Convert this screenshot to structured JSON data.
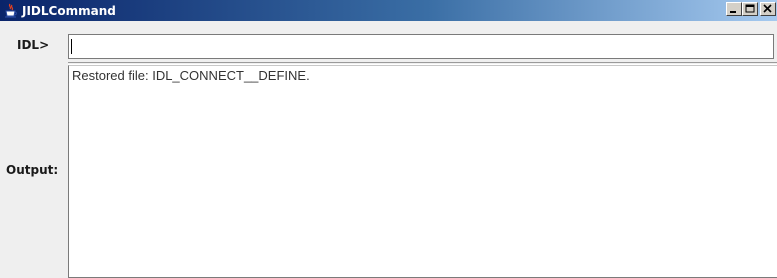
{
  "window": {
    "title": "JIDLCommand",
    "icon": "java-cup-icon",
    "controls": {
      "minimize_icon": "minimize-icon",
      "maximize_icon": "maximize-icon",
      "close_icon": "close-icon"
    }
  },
  "command": {
    "label": "IDL>",
    "value": ""
  },
  "output": {
    "label": "Output:",
    "text": "Restored file: IDL_CONNECT__DEFINE."
  },
  "colors": {
    "titlebar_start": "#0a246a",
    "titlebar_end": "#a6caf0",
    "background": "#efefef"
  }
}
